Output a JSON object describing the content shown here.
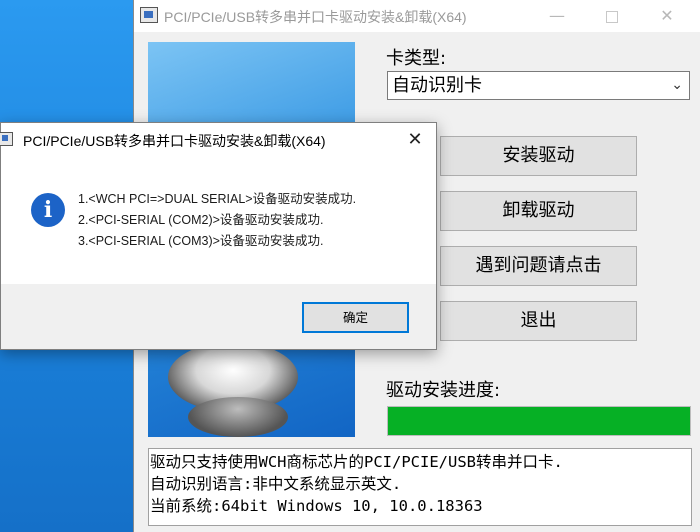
{
  "main_window": {
    "title": "PCI/PCIe/USB转多串并口卡驱动安装&卸载(X64)",
    "minimize_glyph": "—",
    "close_glyph": "✕",
    "card_type_label": "卡类型:",
    "card_type_selected": "自动识别卡",
    "buttons": {
      "install": "安装驱动",
      "uninstall": "卸载驱动",
      "help": "遇到问题请点击",
      "exit": "退出"
    },
    "progress_label": "驱动安装进度:",
    "progress_value": 1.0,
    "progress_color": "#06b025",
    "info_lines": [
      "驱动只支持使用WCH商标芯片的PCI/PCIE/USB转串并口卡.",
      "自动识别语言:非中文系统显示英文.",
      "当前系统:64bit Windows 10, 10.0.18363"
    ]
  },
  "dialog": {
    "title": "PCI/PCIe/USB转多串并口卡驱动安装&卸载(X64)",
    "icon": "info-icon",
    "icon_glyph": "i",
    "close_glyph": "✕",
    "messages": [
      "1.<WCH PCI=>DUAL SERIAL>设备驱动安装成功.",
      "2.<PCI-SERIAL (COM2)>设备驱动安装成功.",
      "3.<PCI-SERIAL (COM3)>设备驱动安装成功."
    ],
    "ok_label": "确定",
    "accent_color": "#0078d7"
  }
}
